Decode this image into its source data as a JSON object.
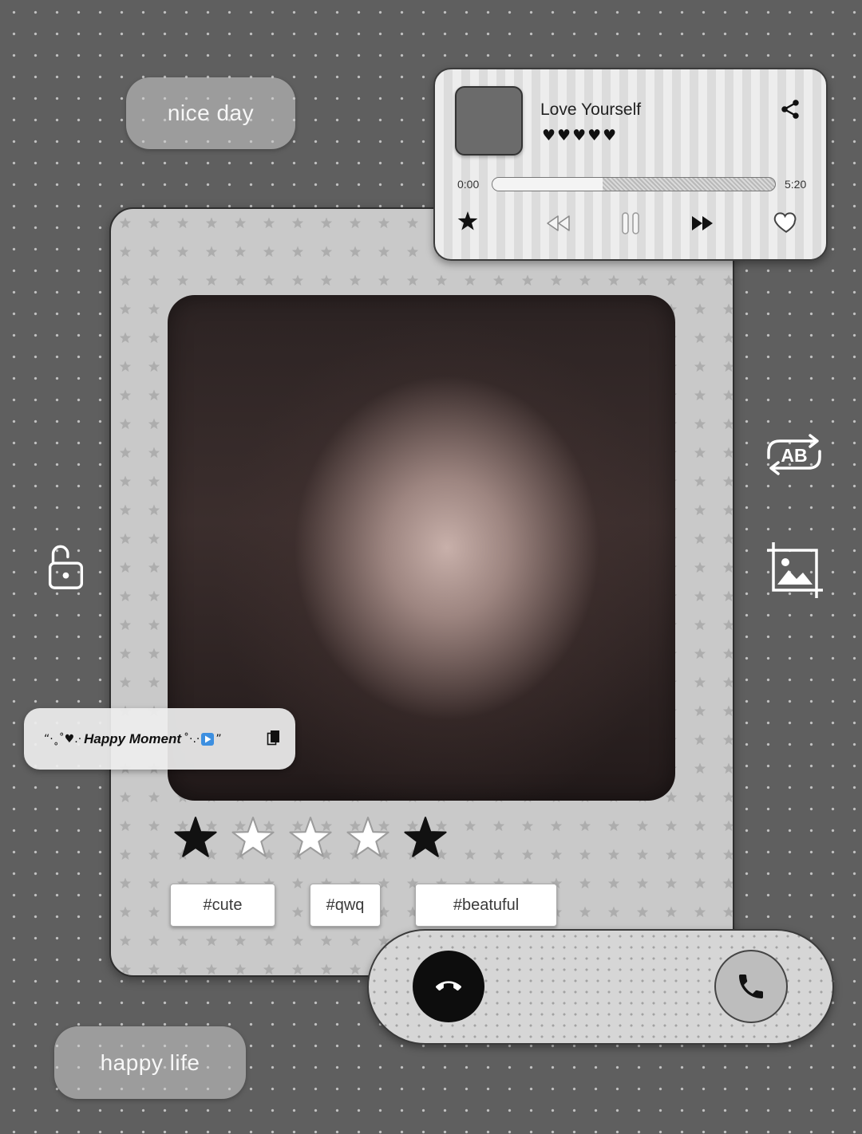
{
  "stickers": {
    "top_label": "nice day",
    "bottom_label": "happy life"
  },
  "player": {
    "title": "Love Yourself",
    "hearts": "♥♥♥♥♥",
    "time_current": "0:00",
    "time_total": "5:20",
    "progress_fill": 0.39,
    "icons": {
      "share": "share-icon",
      "favorite": "star-icon",
      "rewind": "rewind-icon",
      "pause": "pause-icon",
      "forward": "fast-forward-icon",
      "like": "heart-icon"
    }
  },
  "photo_card": {
    "rating": {
      "stars": [
        true,
        false,
        false,
        false,
        true
      ]
    },
    "tags": [
      {
        "label": "#cute"
      },
      {
        "label": "#qwq"
      },
      {
        "label": "#beatuful"
      }
    ]
  },
  "moment": {
    "lead": "“·˳˚♥.·",
    "title": "Happy Moment",
    "trail": "˚·.·",
    "close": "”",
    "icons": {
      "play": "play-icon",
      "bookmark": "bookmark-icon"
    }
  },
  "call": {
    "icons": {
      "decline": "hang-up-icon",
      "accept": "phone-icon"
    }
  },
  "side_tools": {
    "swap_label": "AB",
    "icons": {
      "lock": "unlock-icon",
      "swap": "swap-ab-icon",
      "image": "image-crop-icon"
    }
  },
  "colors": {
    "background": "#5f5f5f",
    "card": "#c9c9c9",
    "accent_dark": "#111111",
    "play_badge": "#3d8fe0"
  }
}
